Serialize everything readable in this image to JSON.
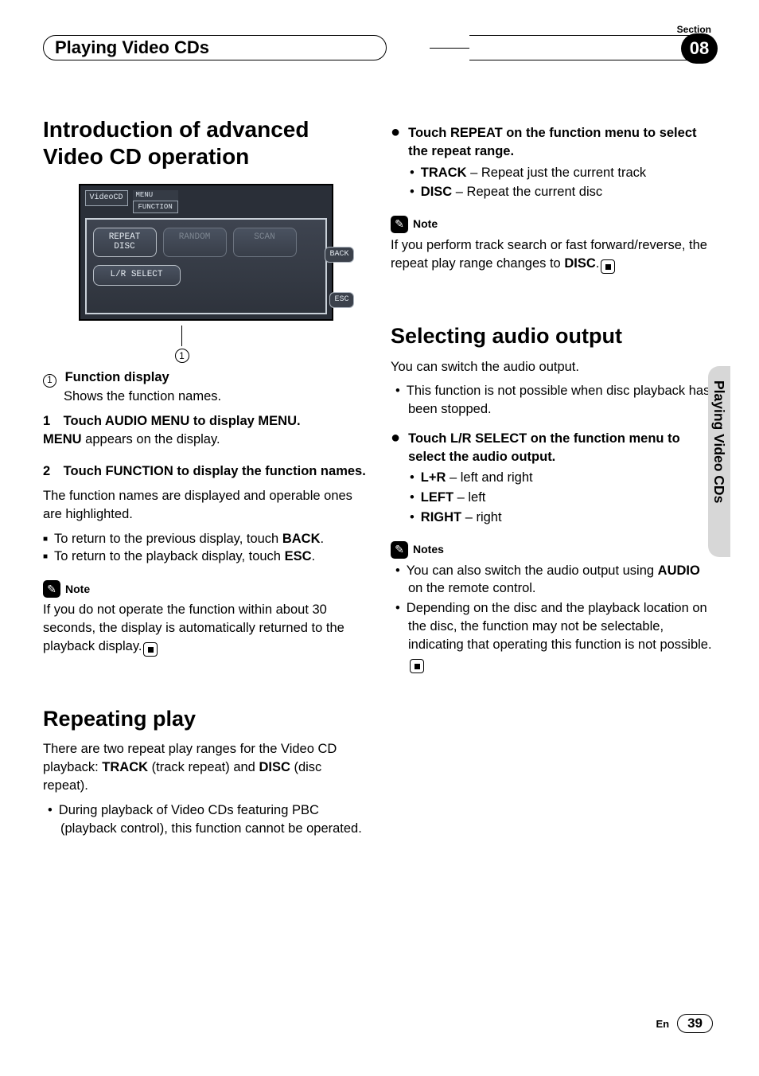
{
  "section": {
    "label": "Section",
    "number": "08",
    "title": "Playing Video CDs"
  },
  "side_tab": "Playing Video CDs",
  "footer": {
    "lang": "En",
    "page": "39"
  },
  "left": {
    "h1": "Introduction of advanced Video CD operation",
    "screenshot": {
      "top_badge": "VideoCD",
      "menu": "MENU",
      "function": "FUNCTION",
      "btn_repeat_l1": "REPEAT",
      "btn_repeat_l2": "DISC",
      "btn_random": "RANDOM",
      "btn_scan": "SCAN",
      "btn_lr": "L/R SELECT",
      "btn_back": "BACK",
      "btn_esc": "ESC"
    },
    "callout_num": "1",
    "callout_title": "Function display",
    "callout_desc": "Shows the function names.",
    "s1_lead": "1 Touch AUDIO MENU to display MENU.",
    "s1_body_a": "MENU",
    "s1_body_b": " appears on the display.",
    "s2_lead": "2 Touch FUNCTION to display the function names.",
    "s2_body": "The function names are displayed and operable ones are highlighted.",
    "s2_li1_a": "To return to the previous display, touch ",
    "s2_li1_b": "BACK",
    "s2_li1_c": ".",
    "s2_li2_a": "To return to the playback display, touch ",
    "s2_li2_b": "ESC",
    "s2_li2_c": ".",
    "note_label": "Note",
    "note_body": "If you do not operate the function within about 30 seconds, the display is automatically returned to the playback display.",
    "h2_repeat": "Repeating play",
    "repeat_p_a": "There are two repeat play ranges for the Video CD playback: ",
    "repeat_p_b": "TRACK",
    "repeat_p_c": " (track repeat) and ",
    "repeat_p_d": "DISC",
    "repeat_p_e": " (disc repeat).",
    "repeat_li": "During playback of Video CDs featuring PBC (playback control), this function cannot be operated."
  },
  "right": {
    "lead1": "Touch REPEAT on the function menu to select the repeat range.",
    "r_li1_a": "TRACK",
    "r_li1_b": " – Repeat just the current track",
    "r_li2_a": "DISC",
    "r_li2_b": " – Repeat the current disc",
    "note_label": "Note",
    "note_body_a": "If you perform track search or fast forward/reverse, the repeat play range changes to ",
    "note_body_b": "DISC",
    "note_body_c": ".",
    "h2_audio": "Selecting audio output",
    "audio_intro": "You can switch the audio output.",
    "audio_li1": "This function is not possible when disc playback has been stopped.",
    "lead2": "Touch L/R SELECT on the function menu to select the audio output.",
    "a_li1_a": "L+R",
    "a_li1_b": " – left and right",
    "a_li2_a": "LEFT",
    "a_li2_b": " – left",
    "a_li3_a": "RIGHT",
    "a_li3_b": " – right",
    "notes_label": "Notes",
    "n_li1_a": "You can also switch the audio output using ",
    "n_li1_b": "AUDIO",
    "n_li1_c": " on the remote control.",
    "n_li2": "Depending on the disc and the playback location on the disc, the function may not be selectable, indicating that operating this function is not possible."
  }
}
